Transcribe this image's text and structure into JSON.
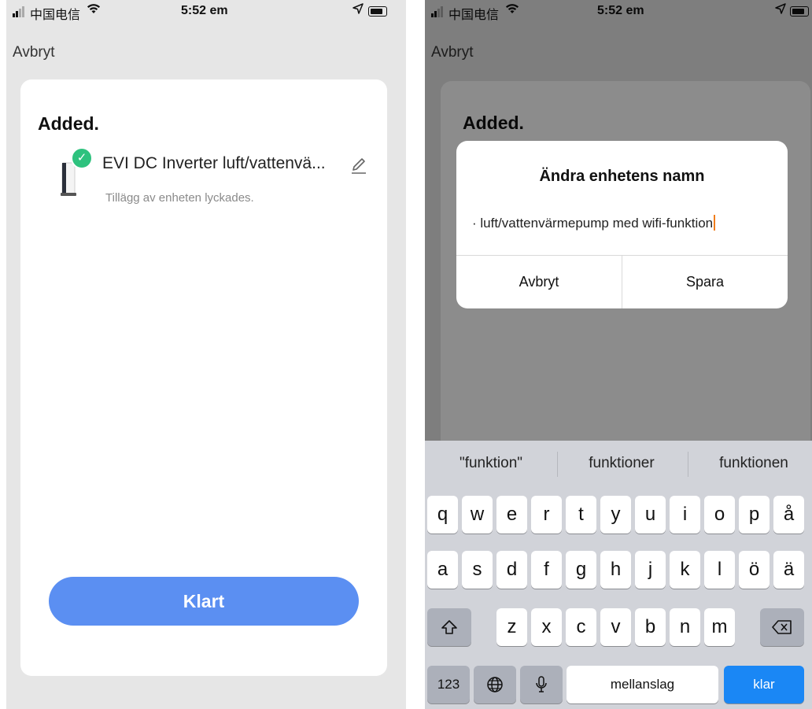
{
  "status_bar": {
    "carrier": "中国电信",
    "time": "5:52 em"
  },
  "left": {
    "nav_cancel": "Avbryt",
    "card": {
      "title": "Added.",
      "device_name": "EVI DC Inverter luft/vattenvä...",
      "device_status": "Tillägg av enheten lyckades.",
      "done_label": "Klart"
    }
  },
  "right": {
    "nav_cancel": "Avbryt",
    "background_title": "Added.",
    "dialog": {
      "title": "Ändra enhetens namn",
      "input_value": "· luft/vattenvärmepump med wifi-funktion",
      "cancel_label": "Avbryt",
      "save_label": "Spara"
    },
    "keyboard": {
      "suggestions": [
        "\"funktion\"",
        "funktioner",
        "funktionen"
      ],
      "row1": [
        "q",
        "w",
        "e",
        "r",
        "t",
        "y",
        "u",
        "i",
        "o",
        "p",
        "å"
      ],
      "row2": [
        "a",
        "s",
        "d",
        "f",
        "g",
        "h",
        "j",
        "k",
        "l",
        "ö",
        "ä"
      ],
      "row3": [
        "z",
        "x",
        "c",
        "v",
        "b",
        "n",
        "m"
      ],
      "numbers_label": "123",
      "space_label": "mellanslag",
      "return_label": "klar"
    }
  },
  "colors": {
    "accent": "#5b8ff2",
    "success": "#2ec27e",
    "keyboard_blue": "#1a87f5",
    "caret": "#ef7d1c"
  },
  "icons": [
    "signal-icon",
    "wifi-icon",
    "location-icon",
    "battery-icon",
    "check-icon",
    "pencil-icon",
    "shift-icon",
    "backspace-icon",
    "globe-icon",
    "microphone-icon"
  ]
}
